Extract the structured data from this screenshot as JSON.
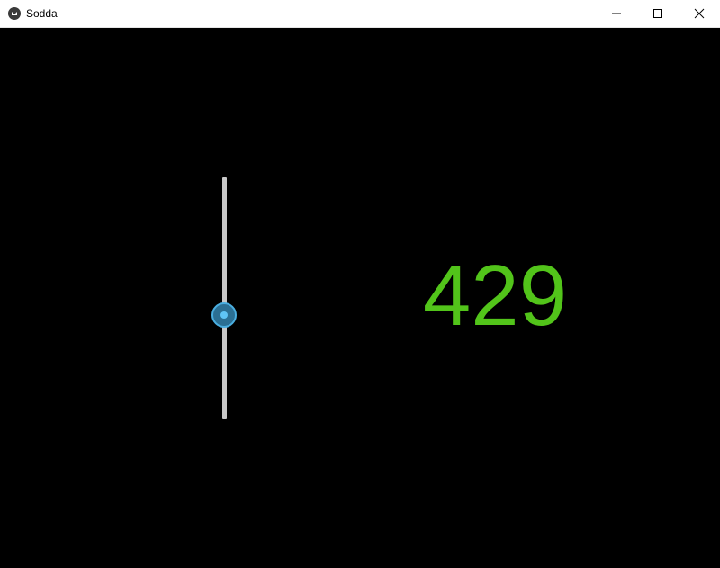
{
  "window": {
    "title": "Sodda",
    "icon": "kivy-app-icon",
    "controls": {
      "minimize_icon": "minimize-icon",
      "maximize_icon": "maximize-icon",
      "close_icon": "close-icon"
    }
  },
  "content": {
    "background_color": "#000000",
    "slider": {
      "orientation": "vertical",
      "level_fraction": 0.43,
      "track_color": "#c8c8c8",
      "handle_color": "#4aaee0"
    },
    "value_label": {
      "text": "429",
      "color": "#52c41a"
    }
  }
}
